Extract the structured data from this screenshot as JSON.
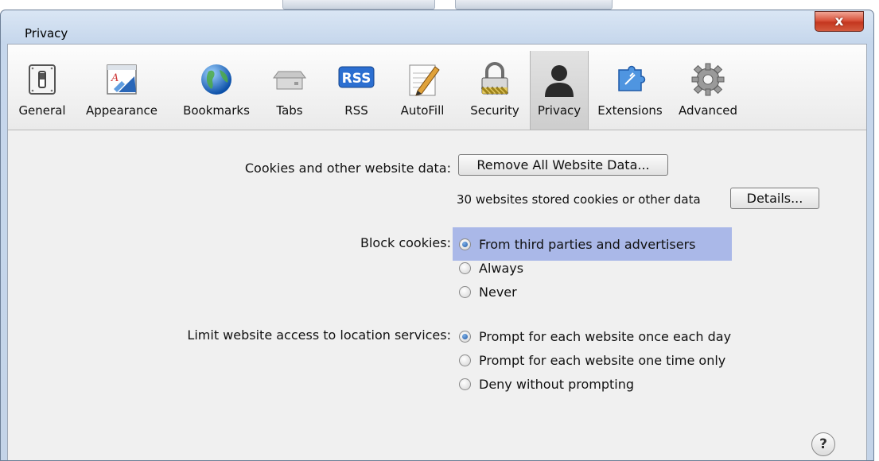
{
  "window": {
    "title": "Privacy",
    "close_glyph": "x"
  },
  "toolbar": {
    "items": [
      {
        "label": "General",
        "icon": "switch-icon"
      },
      {
        "label": "Appearance",
        "icon": "appearance-icon"
      },
      {
        "label": "Bookmarks",
        "icon": "globe-icon"
      },
      {
        "label": "Tabs",
        "icon": "tabs-icon"
      },
      {
        "label": "RSS",
        "icon": "rss-icon",
        "icon_text": "RSS"
      },
      {
        "label": "AutoFill",
        "icon": "autofill-pencil-icon"
      },
      {
        "label": "Security",
        "icon": "lock-icon"
      },
      {
        "label": "Privacy",
        "icon": "person-silhouette-icon",
        "active": true
      },
      {
        "label": "Extensions",
        "icon": "puzzle-icon"
      },
      {
        "label": "Advanced",
        "icon": "gear-icon"
      }
    ]
  },
  "cookies": {
    "label": "Cookies and other website data:",
    "remove_button": "Remove All Website Data...",
    "stored_text": "30 websites stored cookies or other data",
    "details_button": "Details..."
  },
  "block_cookies": {
    "label": "Block cookies:",
    "options": [
      {
        "label": "From third parties and advertisers",
        "selected": true
      },
      {
        "label": "Always",
        "selected": false
      },
      {
        "label": "Never",
        "selected": false
      }
    ]
  },
  "location": {
    "label": "Limit website access to location services:",
    "options": [
      {
        "label": "Prompt for each website once each day",
        "selected": true
      },
      {
        "label": "Prompt for each website one time only",
        "selected": false
      },
      {
        "label": "Deny without prompting",
        "selected": false
      }
    ]
  },
  "help": {
    "glyph": "?"
  },
  "colors": {
    "selection_highlight": "#aab8e8",
    "titlebar": "#c6d7ec",
    "close_button": "#c4371f"
  }
}
